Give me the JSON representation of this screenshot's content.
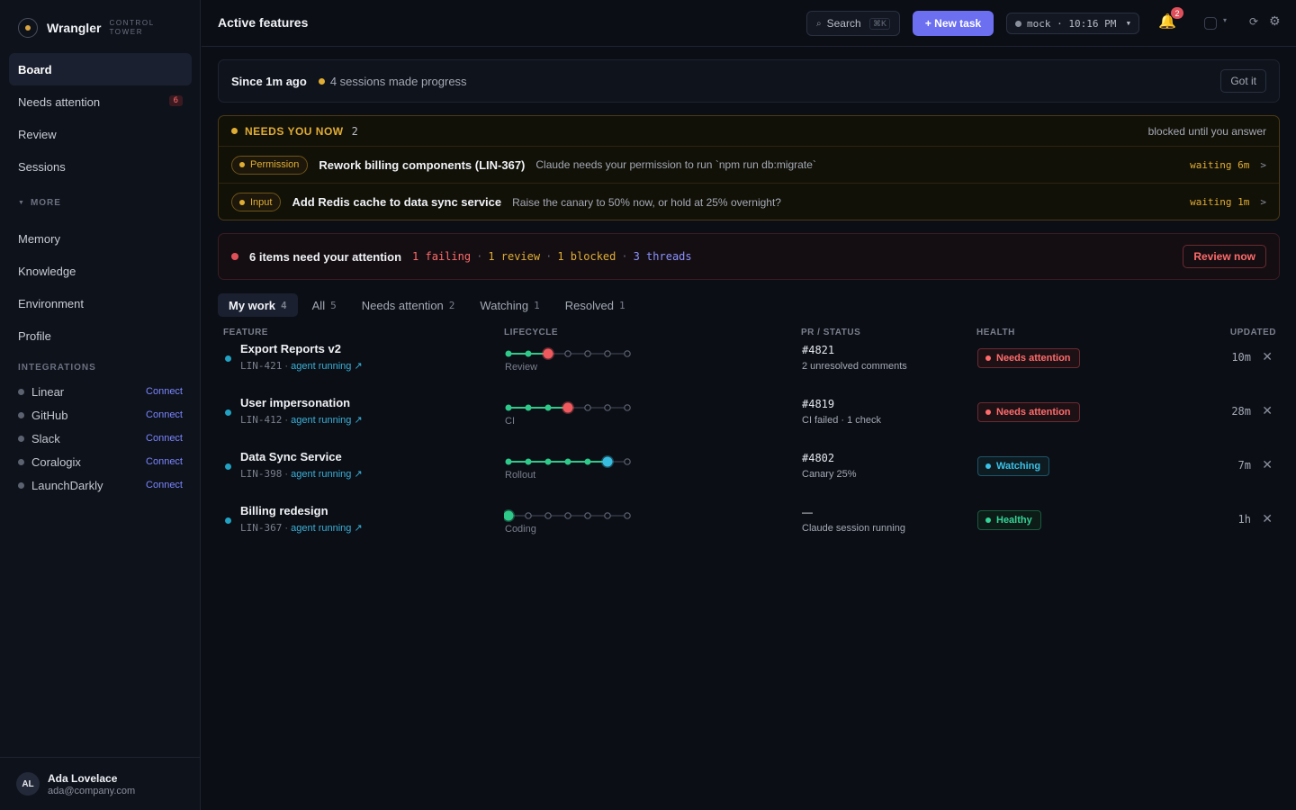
{
  "brand": {
    "name": "Wrangler",
    "subtitle": "CONTROL TOWER"
  },
  "nav": {
    "items": [
      {
        "label": "Board",
        "active": true
      },
      {
        "label": "Needs attention",
        "badge": "6"
      },
      {
        "label": "Review"
      },
      {
        "label": "Sessions"
      }
    ],
    "more_label": "MORE",
    "more_items": [
      {
        "label": "Memory"
      },
      {
        "label": "Knowledge"
      },
      {
        "label": "Environment"
      },
      {
        "label": "Profile"
      }
    ]
  },
  "integrations": {
    "title": "INTEGRATIONS",
    "connect_label": "Connect",
    "items": [
      {
        "name": "Linear"
      },
      {
        "name": "GitHub"
      },
      {
        "name": "Slack"
      },
      {
        "name": "Coralogix"
      },
      {
        "name": "LaunchDarkly"
      }
    ]
  },
  "user": {
    "initials": "AL",
    "name": "Ada Lovelace",
    "email": "ada@company.com"
  },
  "topbar": {
    "title": "Active features",
    "search_label": "Search",
    "search_shortcut": "⌘K",
    "new_task_label": "+ New task",
    "env_label": "mock · 10:16 PM",
    "notifications_count": "2"
  },
  "since": {
    "title": "Since 1m ago",
    "text": "4 sessions made progress",
    "dismiss_label": "Got it"
  },
  "needs": {
    "title": "NEEDS YOU NOW",
    "count": "2",
    "right_text": "blocked until you answer",
    "rows": [
      {
        "tag": "Permission",
        "name": "Rework billing components (LIN-367)",
        "desc": "Claude needs your permission to run `npm run db:migrate`",
        "wait": "waiting 6m"
      },
      {
        "tag": "Input",
        "name": "Add Redis cache to data sync service",
        "desc": "Raise the canary to 50% now, or hold at 25% overnight?",
        "wait": "waiting 1m"
      }
    ]
  },
  "attention": {
    "title": "6 items need your attention",
    "failing": "1 failing",
    "review": "1 review",
    "blocked": "1 blocked",
    "threads": "3 threads",
    "button_label": "Review now"
  },
  "tabs": [
    {
      "label": "My work",
      "count": "4",
      "active": true
    },
    {
      "label": "All",
      "count": "5"
    },
    {
      "label": "Needs attention",
      "count": "2"
    },
    {
      "label": "Watching",
      "count": "1"
    },
    {
      "label": "Resolved",
      "count": "1"
    }
  ],
  "table": {
    "columns": {
      "feature": "FEATURE",
      "lifecycle": "LIFECYCLE",
      "pr": "PR / STATUS",
      "health": "HEALTH",
      "updated": "UPDATED"
    },
    "rows": [
      {
        "title": "Export Reports v2",
        "id": "LIN-421",
        "agent": "agent running ↗",
        "lifecycle_total": 7,
        "lifecycle_current": 3,
        "lifecycle_color": "red",
        "lifecycle_label": "Review",
        "pr": "#4821",
        "pr_desc": "2 unresolved comments",
        "health": "Needs attention",
        "health_kind": "red",
        "updated": "10m"
      },
      {
        "title": "User impersonation",
        "id": "LIN-412",
        "agent": "agent running ↗",
        "lifecycle_total": 7,
        "lifecycle_current": 4,
        "lifecycle_color": "red",
        "lifecycle_label": "CI",
        "pr": "#4819",
        "pr_desc": "CI failed · 1 check",
        "health": "Needs attention",
        "health_kind": "red",
        "updated": "28m"
      },
      {
        "title": "Data Sync Service",
        "id": "LIN-398",
        "agent": "agent running ↗",
        "lifecycle_total": 7,
        "lifecycle_current": 6,
        "lifecycle_color": "blue",
        "lifecycle_label": "Rollout",
        "pr": "#4802",
        "pr_desc": "Canary 25%",
        "health": "Watching",
        "health_kind": "blue",
        "updated": "7m"
      },
      {
        "title": "Billing redesign",
        "id": "LIN-367",
        "agent": "agent running ↗",
        "lifecycle_total": 7,
        "lifecycle_current": 1,
        "lifecycle_color": "green",
        "lifecycle_label": "Coding",
        "pr": "—",
        "pr_desc": "Claude session running",
        "health": "Healthy",
        "health_kind": "green",
        "updated": "1h"
      }
    ]
  },
  "colors": {
    "accent": "#6b6ff0",
    "warning": "#e0ad34",
    "danger": "#ff6b6b",
    "info": "#3ac2e8",
    "success": "#34d399"
  }
}
